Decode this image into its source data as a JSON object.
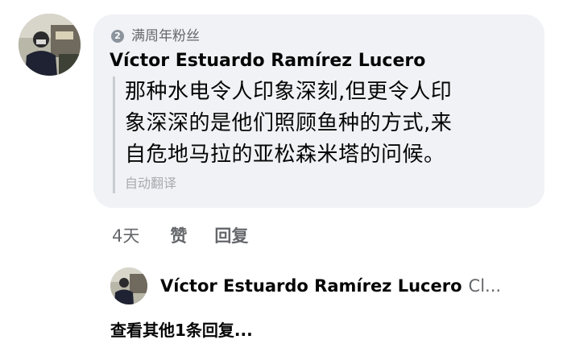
{
  "comment": {
    "badge_icon": "2",
    "badge_text": "满周年粉丝",
    "author": "Víctor Estuardo Ramírez Lucero",
    "text_line_1": "那种水电令人印象深刻,但更令人印",
    "text_line_2": "象深深的是他们照顾鱼种的方式,来",
    "text_line_3": "自危地马拉的亚松森米塔的问候。",
    "auto_translate": "自动翻译"
  },
  "actions": {
    "time": "4天",
    "like": "赞",
    "reply": "回复"
  },
  "reply": {
    "author": "Víctor Estuardo Ramírez Lucero",
    "snippet": "Cl..."
  },
  "more_replies": "查看其他1条回复...",
  "colors": {
    "bubble_bg": "#f0f2f5",
    "secondary_text": "#65676b",
    "primary_text": "#050505"
  },
  "icons": {
    "badge": "top-fan-badge-icon"
  }
}
